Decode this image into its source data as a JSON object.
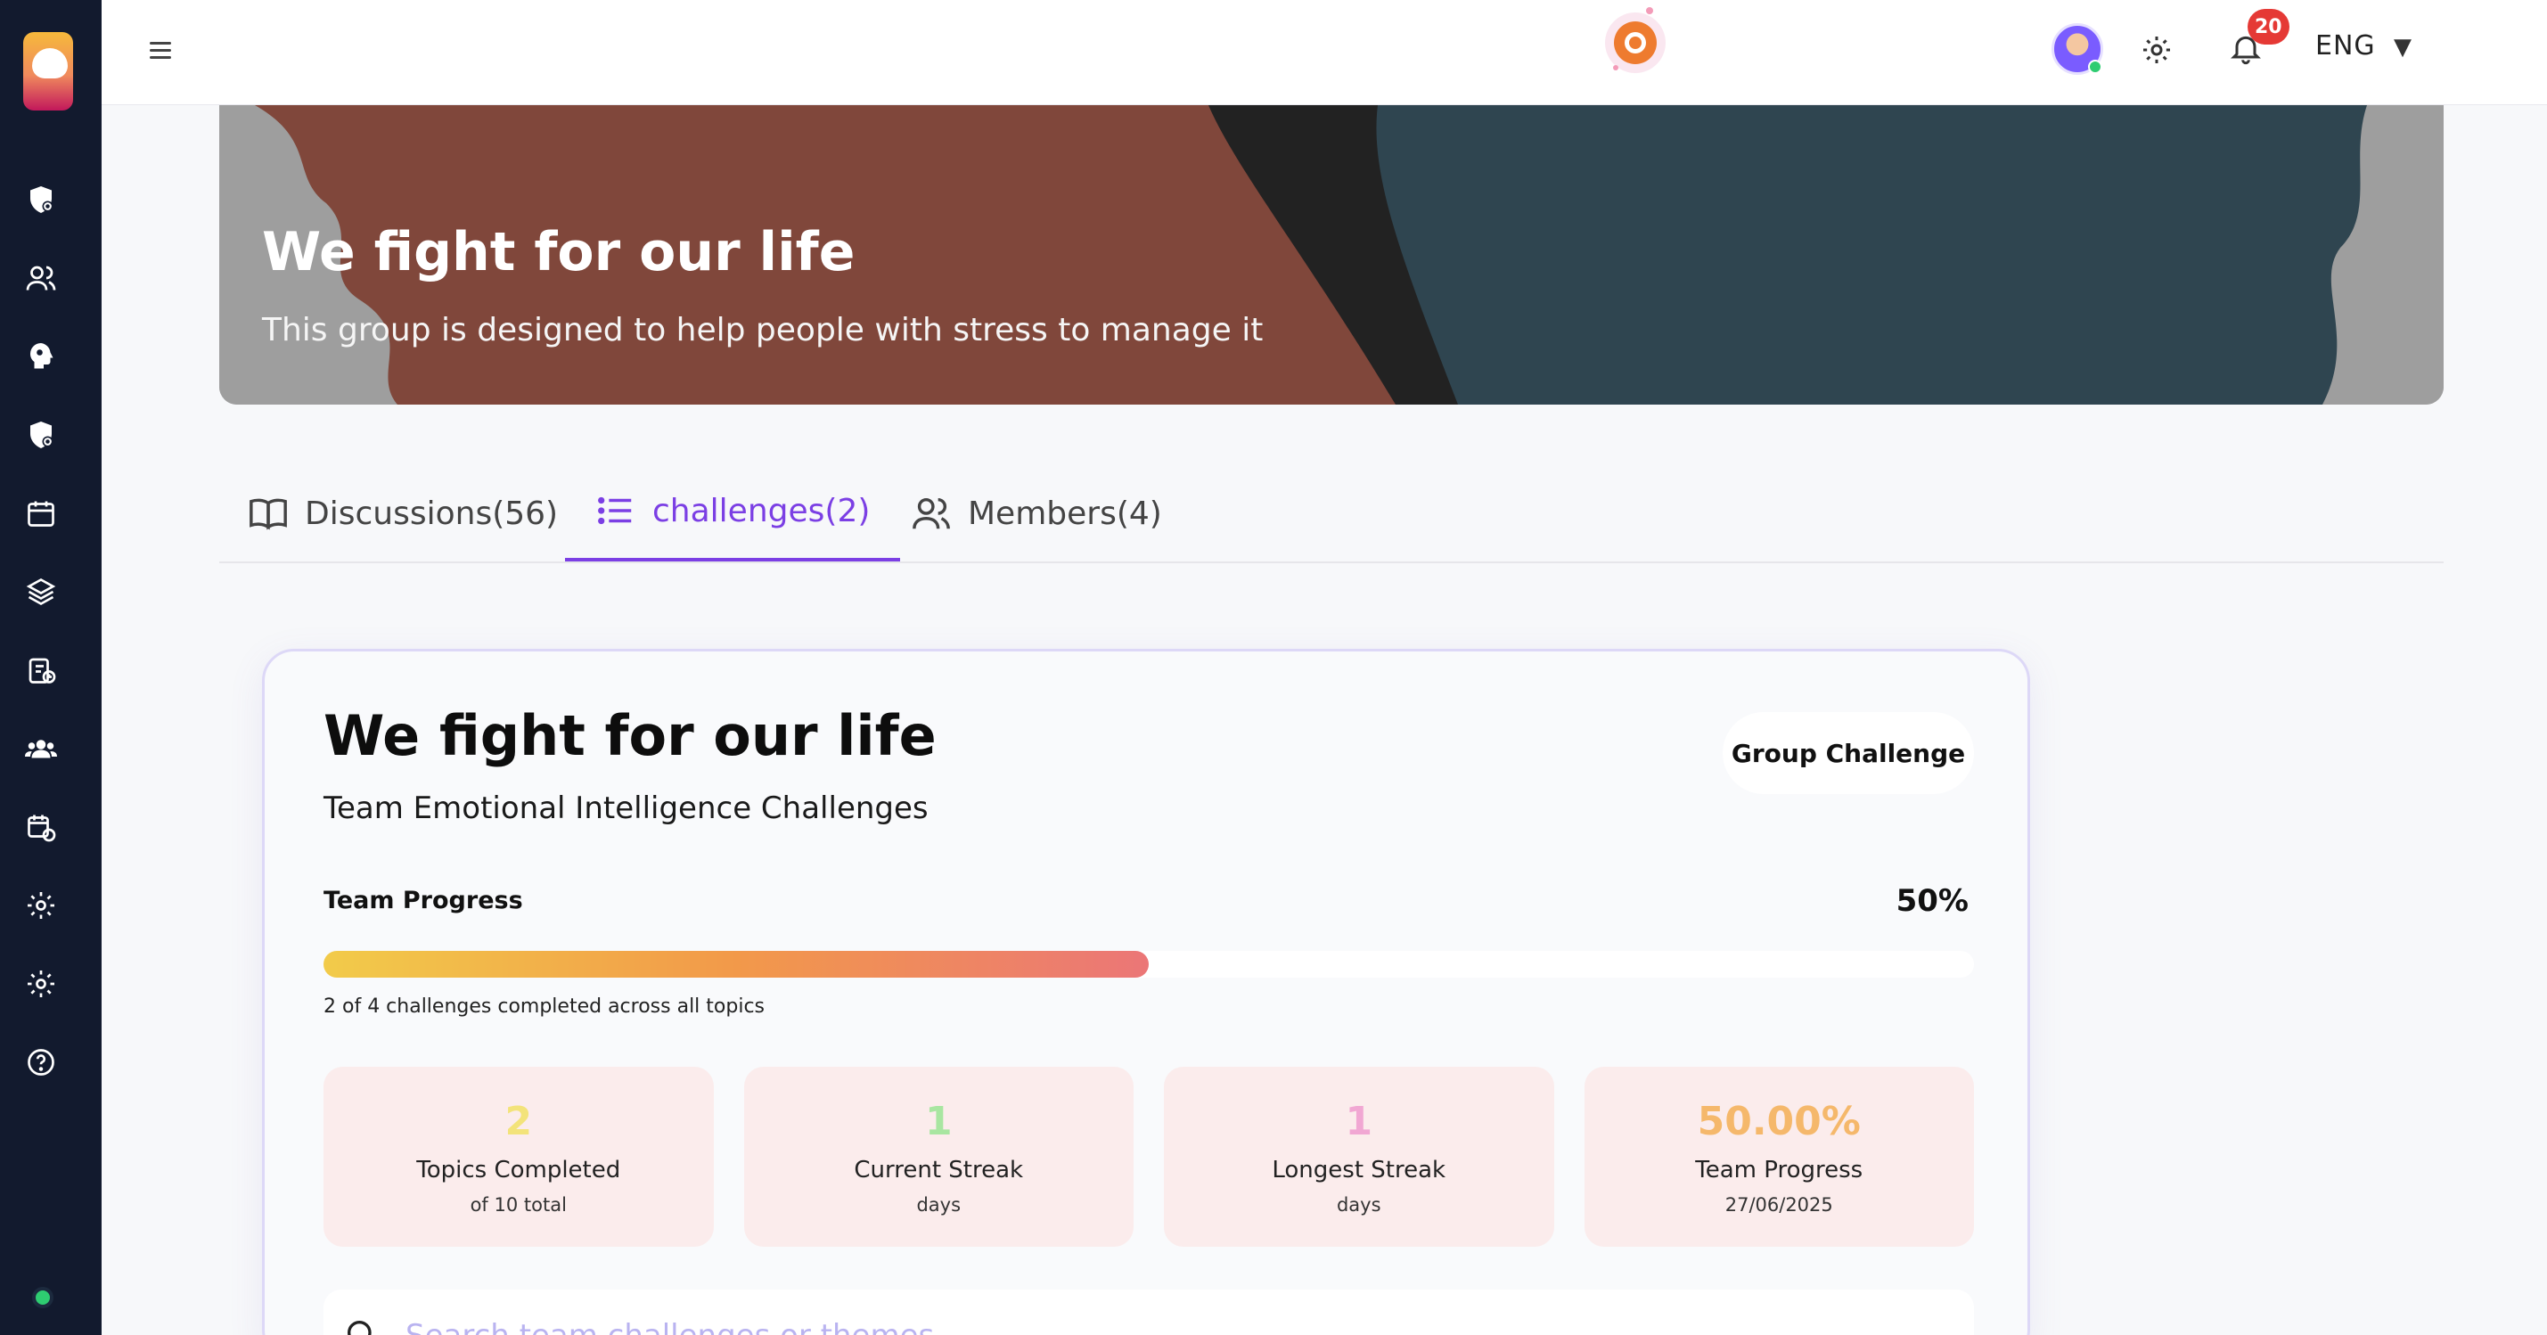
{
  "topbar": {
    "notifications_count": "20",
    "language": "ENG",
    "language_caret": "▼"
  },
  "sidebar": {
    "items": [
      {
        "icon": "shield-settings-icon"
      },
      {
        "icon": "users-icon"
      },
      {
        "icon": "brain-icon"
      },
      {
        "icon": "shield-settings-icon"
      },
      {
        "icon": "calendar-icon"
      },
      {
        "icon": "layers-icon"
      },
      {
        "icon": "clipboard-clock-icon"
      },
      {
        "icon": "group-icon"
      },
      {
        "icon": "calendar-refresh-icon"
      },
      {
        "icon": "gear-icon"
      },
      {
        "icon": "gear-icon"
      },
      {
        "icon": "help-icon"
      }
    ]
  },
  "banner": {
    "title": "We fight for our life",
    "subtitle": "This group is designed to help people with stress to manage it"
  },
  "tabs": [
    {
      "label": "Discussions(56)",
      "icon": "book-icon",
      "active": false
    },
    {
      "label": "challenges(2)",
      "icon": "list-icon",
      "active": true
    },
    {
      "label": "Members(4)",
      "icon": "users-icon",
      "active": false
    }
  ],
  "card": {
    "title": "We fight for our life",
    "subtitle": "Team Emotional Intelligence Challenges",
    "pill": "Group Challenge",
    "progress_label": "Team Progress",
    "progress_value": "50%",
    "progress_fraction": 0.5,
    "progress_note": "2 of 4 challenges completed across all topics",
    "stats": [
      {
        "value": "2",
        "label": "Topics Completed",
        "sub": "of 10 total",
        "color": "#f3e37a"
      },
      {
        "value": "1",
        "label": "Current Streak",
        "sub": "days",
        "color": "#a8e6a1"
      },
      {
        "value": "1",
        "label": "Longest Streak",
        "sub": "days",
        "color": "#f1a7d3"
      },
      {
        "value": "50.00%",
        "label": "Team Progress",
        "sub": "27/06/2025",
        "color": "#f5b86b"
      }
    ],
    "search_placeholder": "Search team challenges or themes..."
  },
  "colors": {
    "accent": "#7b3fe4",
    "sidebar_bg": "#121a2e",
    "badge": "#e53935"
  }
}
